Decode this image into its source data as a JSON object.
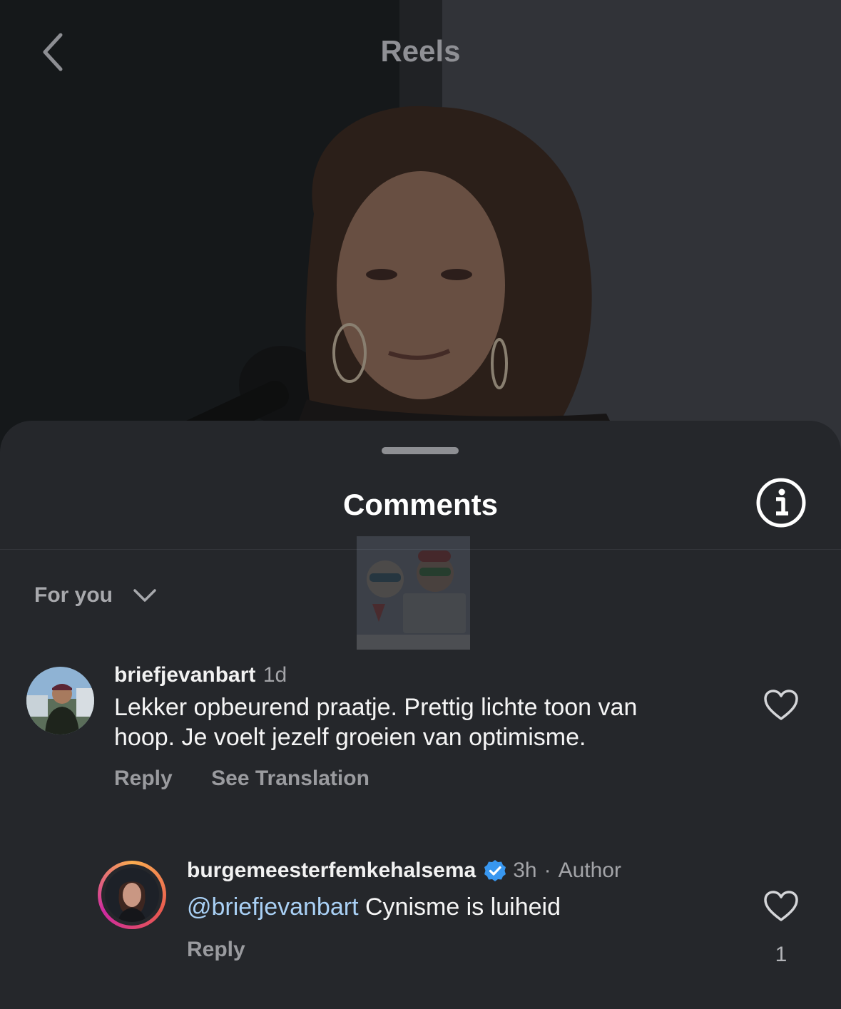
{
  "header": {
    "title": "Reels"
  },
  "sheet": {
    "title": "Comments",
    "filter": {
      "label": "For you"
    }
  },
  "comments": [
    {
      "username": "briefjevanbart",
      "time": "1d",
      "text_line1": "Lekker opbeurend praatje. Prettig lichte toon van",
      "text_line2": "hoop. Je voelt jezelf groeien van optimisme.",
      "reply_label": "Reply",
      "translate_label": "See Translation"
    }
  ],
  "replies": [
    {
      "username": "burgemeesterfemkehalsema",
      "verified": true,
      "time": "3h",
      "separator": "·",
      "author_label": "Author",
      "mention": "@briefjevanbart",
      "text": "Cynisme is luiheid",
      "reply_label": "Reply",
      "like_count": "1"
    }
  ],
  "icons": {
    "back": "chevron-left-icon",
    "info": "info-icon",
    "filter": "chevron-down-icon",
    "like": "heart-icon",
    "verified": "verified-badge-icon"
  },
  "colors": {
    "sheet_bg": "#25272b",
    "mention": "#a9d0f5",
    "verified": "#3897f0",
    "story_ring_start": "#fbad50",
    "story_ring_end": "#cd2aa0"
  }
}
